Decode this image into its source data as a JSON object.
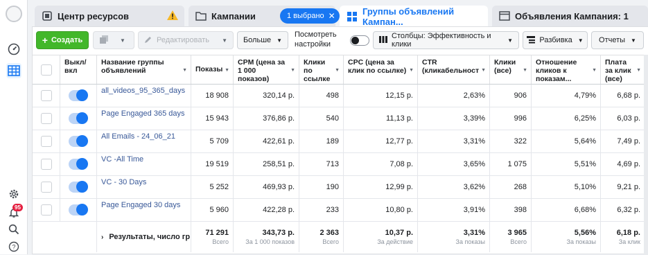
{
  "tabs": {
    "resources": "Центр ресурсов",
    "campaigns": "Кампании",
    "selected_pill": "1 выбрано",
    "adsets": "Группы объявлений Кампан...",
    "ads": "Объявления Кампания: 1"
  },
  "rail": {
    "notifications_count": "95"
  },
  "toolbar": {
    "create": "Создать",
    "edit": "Редактировать",
    "more": "Больше",
    "view_settings": "Посмотреть настройки",
    "columns": "Столбцы: Эффективность и клики",
    "breakdown": "Разбивка",
    "reports": "Отчеты"
  },
  "columns": {
    "toggle": "Выкл/ вкл",
    "name": "Название группы объявлений",
    "impressions": "Показы",
    "cpm": "CPM (цена за 1 000 показов)",
    "link_clicks": "Клики по ссылке",
    "cpc": "CPC (цена за клик по ссылке)",
    "ctr": "CTR (кликабельност",
    "clicks_all": "Клики (все)",
    "click_ratio": "Отношение кликов к показам...",
    "cost_per_click": "Плата за клик (все)"
  },
  "rows": [
    {
      "name": "all_videos_95_365_days",
      "impressions": "18 908",
      "cpm": "320,14 р.",
      "link_clicks": "498",
      "cpc": "12,15 р.",
      "ctr": "2,63%",
      "clicks_all": "906",
      "click_ratio": "4,79%",
      "cost_per_click": "6,68 р."
    },
    {
      "name": "Page Engaged 365 days",
      "impressions": "15 943",
      "cpm": "376,86 р.",
      "link_clicks": "540",
      "cpc": "11,13 р.",
      "ctr": "3,39%",
      "clicks_all": "996",
      "click_ratio": "6,25%",
      "cost_per_click": "6,03 р."
    },
    {
      "name": "All Emails - 24_06_21",
      "impressions": "5 709",
      "cpm": "422,61 р.",
      "link_clicks": "189",
      "cpc": "12,77 р.",
      "ctr": "3,31%",
      "clicks_all": "322",
      "click_ratio": "5,64%",
      "cost_per_click": "7,49 р."
    },
    {
      "name": "VC -All Time",
      "impressions": "19 519",
      "cpm": "258,51 р.",
      "link_clicks": "713",
      "cpc": "7,08 р.",
      "ctr": "3,65%",
      "clicks_all": "1 075",
      "click_ratio": "5,51%",
      "cost_per_click": "4,69 р."
    },
    {
      "name": "VC - 30 Days",
      "impressions": "5 252",
      "cpm": "469,93 р.",
      "link_clicks": "190",
      "cpc": "12,99 р.",
      "ctr": "3,62%",
      "clicks_all": "268",
      "click_ratio": "5,10%",
      "cost_per_click": "9,21 р."
    },
    {
      "name": "Page Engaged 30 days",
      "impressions": "5 960",
      "cpm": "422,28 р.",
      "link_clicks": "233",
      "cpc": "10,80 р.",
      "ctr": "3,91%",
      "clicks_all": "398",
      "click_ratio": "6,68%",
      "cost_per_click": "6,32 р."
    }
  ],
  "totals": {
    "label": "Результаты, число гр",
    "impressions": "71 291",
    "impressions_sub": "Всего",
    "cpm": "343,73 р.",
    "cpm_sub": "За 1 000 показов",
    "link_clicks": "2 363",
    "link_clicks_sub": "Всего",
    "cpc": "10,37 р.",
    "cpc_sub": "За действие",
    "ctr": "3,31%",
    "ctr_sub": "За показы",
    "clicks_all": "3 965",
    "clicks_all_sub": "Всего",
    "click_ratio": "5,56%",
    "click_ratio_sub": "За показы",
    "cost_per_click": "6,18 р.",
    "cost_per_click_sub": "За клик"
  },
  "colors": {
    "accent": "#1877f2",
    "create": "#42b72a",
    "link": "#385898",
    "warning": "#f7b928"
  }
}
